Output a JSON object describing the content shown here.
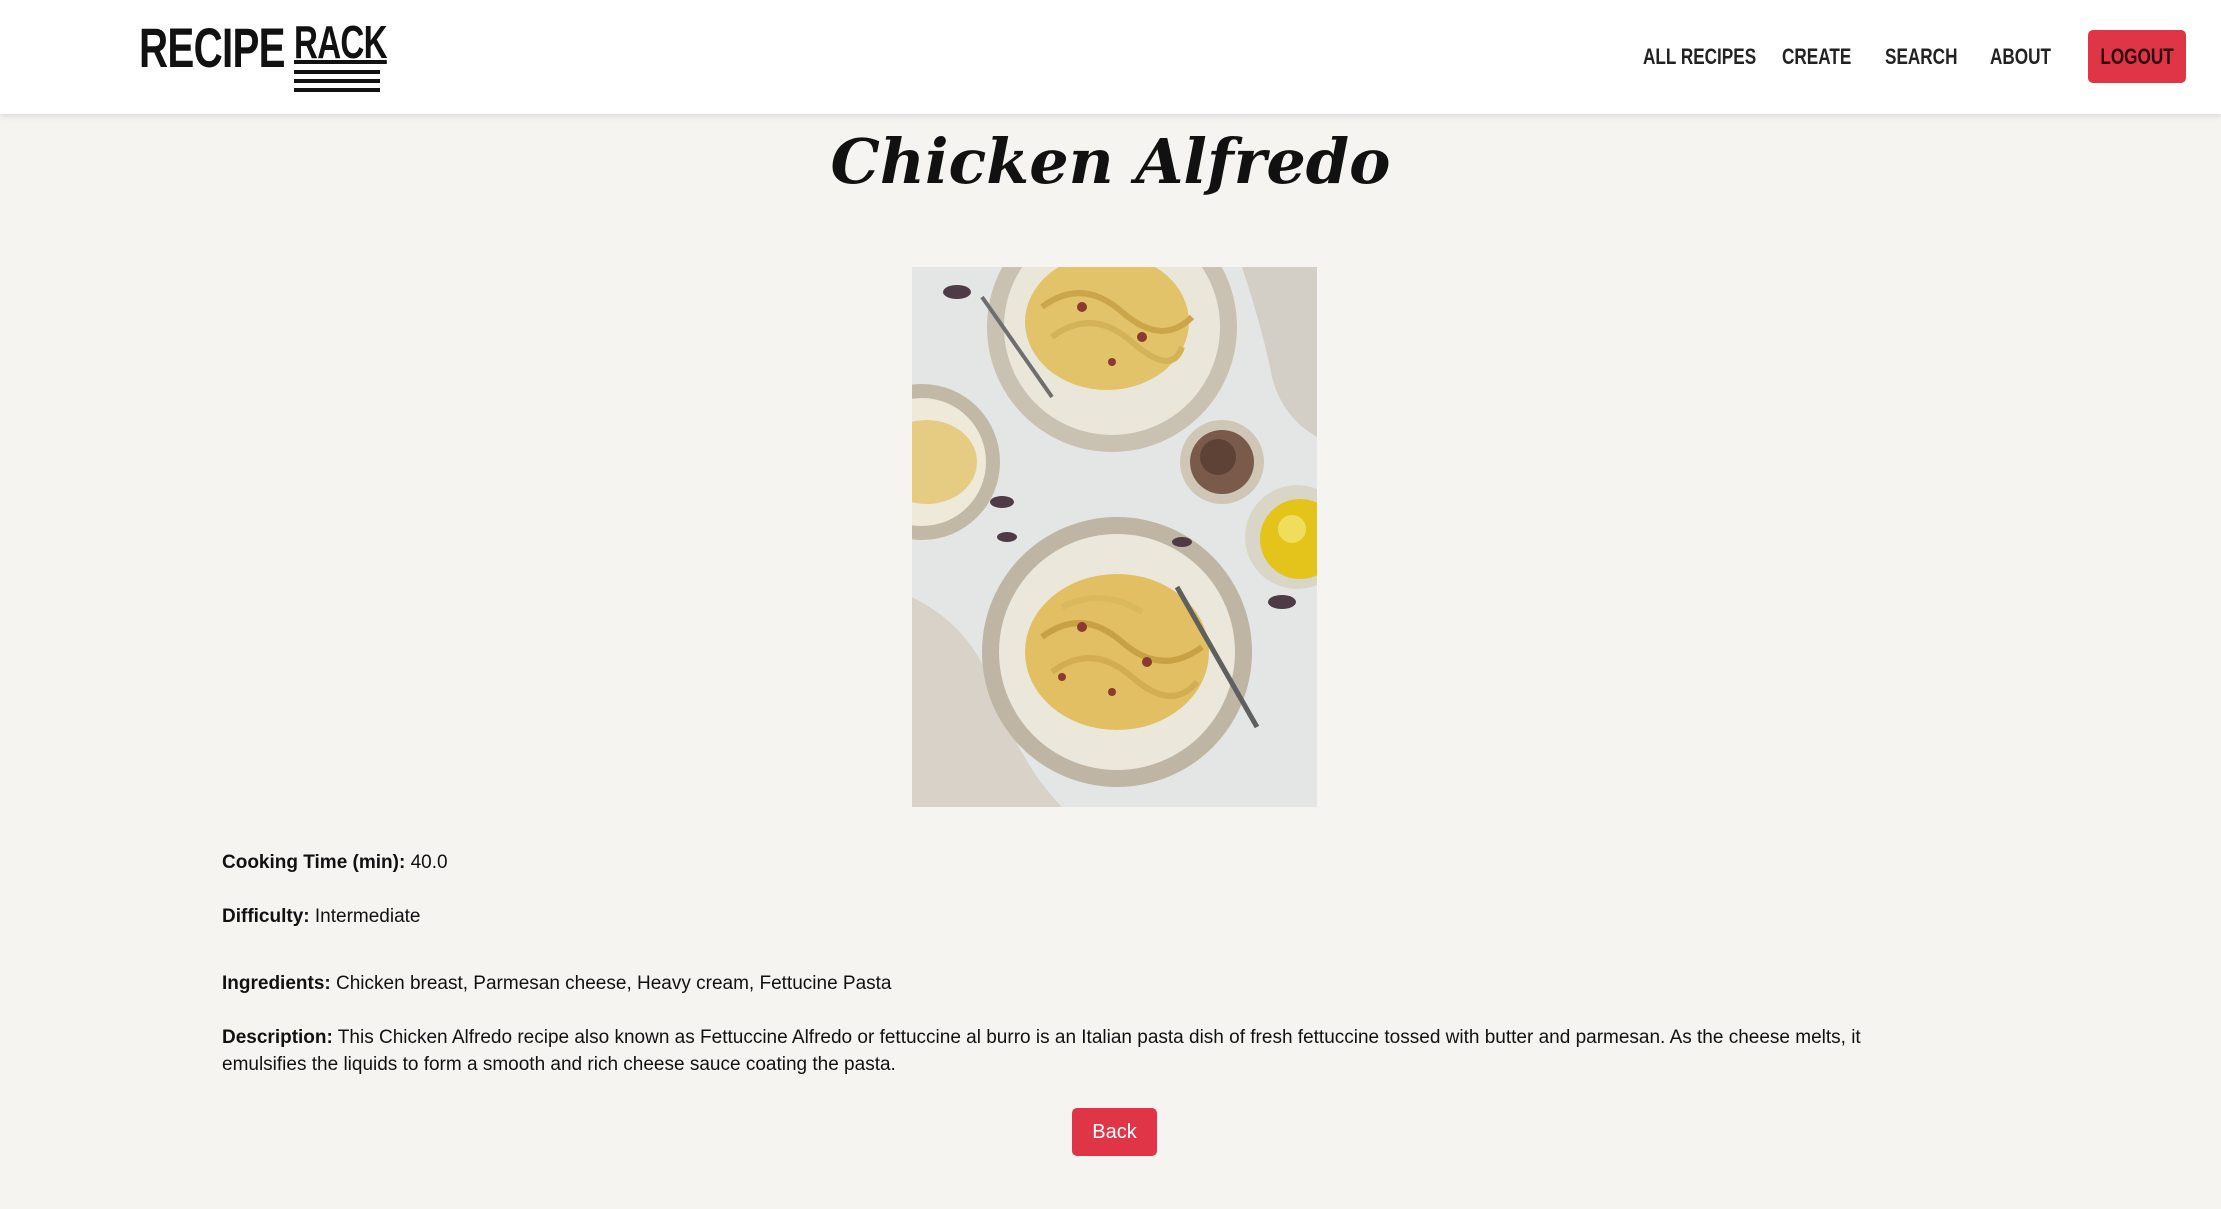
{
  "brand": {
    "left": "RECIPE",
    "right": "RACK"
  },
  "nav": {
    "links": [
      "ALL RECIPES",
      "CREATE",
      "SEARCH",
      "ABOUT"
    ],
    "logout_label": "LOGOUT"
  },
  "recipe": {
    "title": "Chicken Alfredo",
    "image_icon": "pasta-photo",
    "cooking_time_label": "Cooking Time (min):",
    "cooking_time_value": "40.0",
    "difficulty_label": "Difficulty:",
    "difficulty_value": "Intermediate",
    "ingredients_label": "Ingredients:",
    "ingredients_value": "Chicken breast, Parmesan cheese, Heavy cream, Fettucine Pasta",
    "description_label": "Description:",
    "description_value": "This Chicken Alfredo recipe also known as Fettuccine Alfredo or fettuccine al burro is an Italian pasta dish of fresh fettuccine tossed with butter and parmesan. As the cheese melts, it emulsifies the liquids to form a smooth and rich cheese sauce coating the pasta."
  },
  "actions": {
    "back_label": "Back"
  },
  "colors": {
    "accent": "#e03546",
    "background": "#f5f4f1",
    "navbar": "#ffffff"
  }
}
